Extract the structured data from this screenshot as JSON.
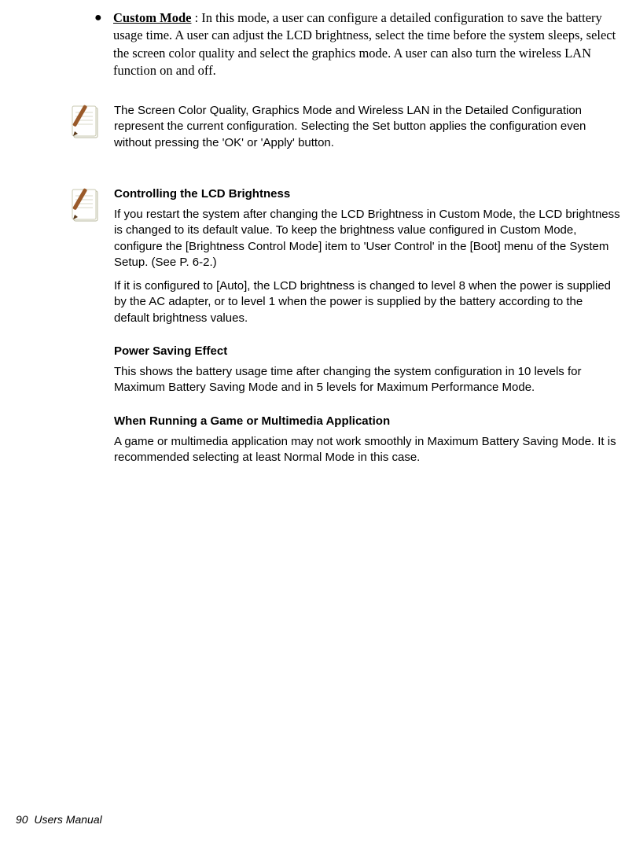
{
  "bullet": {
    "label": "Custom Mode",
    "text": " : In this mode, a user can configure a detailed configuration to save the battery usage time. A user can adjust the LCD brightness, select the time before the system sleeps, select the screen color quality and select the graphics mode. A user can also turn the wireless LAN function on and off."
  },
  "note1": {
    "p1": "The Screen Color Quality, Graphics Mode and Wireless LAN in the Detailed Configuration represent the current configuration. Selecting the Set button applies the configuration even without pressing the 'OK' or 'Apply' button."
  },
  "note2": {
    "h1": "Controlling the LCD Brightness",
    "p1": "If you restart the system after changing the LCD Brightness in Custom Mode, the LCD brightness is changed to its default value. To keep the brightness value configured in Custom Mode, configure the [Brightness Control Mode] item to 'User Control' in the [Boot] menu of the System Setup. (See P. 6-2.)",
    "p2": "If it is configured to [Auto], the LCD brightness is changed to level 8 when the power is supplied by the AC adapter, or to level 1 when the power is supplied by the battery according to the default brightness values.",
    "h2": "Power Saving Effect",
    "p3": "This shows the battery usage time after changing the system configuration in 10 levels for Maximum Battery Saving Mode and in 5 levels for Maximum Performance Mode.",
    "h3": "When Running a Game or Multimedia Application",
    "p4": "A game or multimedia application may not work smoothly in Maximum Battery Saving Mode. It is recommended selecting at least Normal Mode in this case."
  },
  "footer": {
    "page": "90",
    "title": "Users Manual"
  }
}
